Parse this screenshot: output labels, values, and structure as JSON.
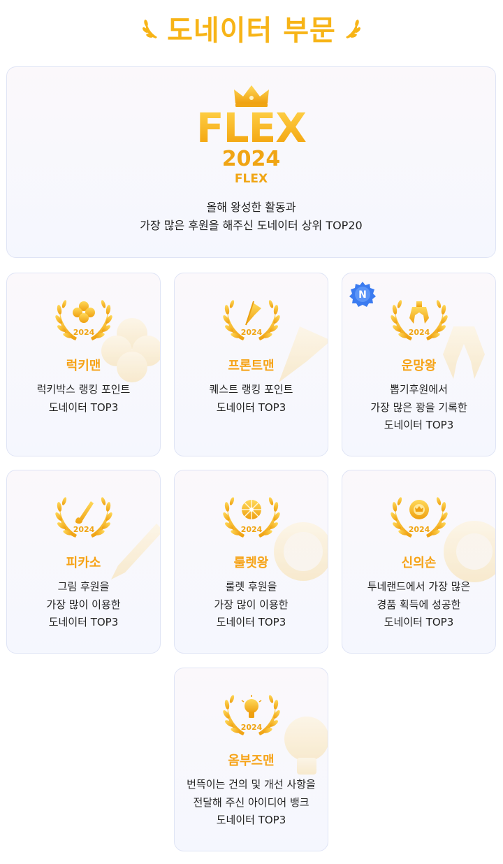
{
  "header": {
    "title": "도네이터 부문"
  },
  "flex": {
    "logo_text": "FLEX",
    "year": "2024",
    "sub": "FLEX",
    "desc_lines": [
      "올해 왕성한 활동과",
      "가장 많은 후원을 해주신 도네이터 상위 TOP20"
    ]
  },
  "awards": [
    {
      "name": "럭키맨",
      "icon": "clover-icon",
      "year": "2024",
      "lines": [
        "럭키박스 랭킹 포인트",
        "도네이터 TOP3"
      ]
    },
    {
      "name": "프론트맨",
      "icon": "flag-icon",
      "year": "2024",
      "lines": [
        "퀘스트 랭킹 포인트",
        "도네이터 TOP3"
      ]
    },
    {
      "name": "운망왕",
      "icon": "claw-icon",
      "year": "2024",
      "badge": "N",
      "lines": [
        "뽑기후원에서",
        "가장 많은 꽝을 기록한",
        "도네이터 TOP3"
      ]
    },
    {
      "name": "피카소",
      "icon": "paintbrush-icon",
      "year": "2024",
      "lines": [
        "그림 후원을",
        "가장 많이 이용한",
        "도네이터 TOP3"
      ]
    },
    {
      "name": "룰렛왕",
      "icon": "roulette-icon",
      "year": "2024",
      "lines": [
        "룰렛 후원을",
        "가장 많이 이용한",
        "도네이터 TOP3"
      ]
    },
    {
      "name": "신의손",
      "icon": "chip-icon",
      "year": "2024",
      "lines": [
        "투네랜드에서 가장 많은",
        "경품 획득에 성공한",
        "도네이터 TOP3"
      ]
    },
    {
      "name": "옴부즈맨",
      "icon": "lightbulb-icon",
      "year": "2024",
      "lines": [
        "번뜩이는 건의 및 개선 사항을",
        "전달해 주신 아이디어 뱅크",
        "도네이터 TOP3"
      ]
    }
  ],
  "colors": {
    "gold": "#F6A316",
    "border": "#dfe4f5",
    "badge_blue": "#3B7BF0"
  }
}
